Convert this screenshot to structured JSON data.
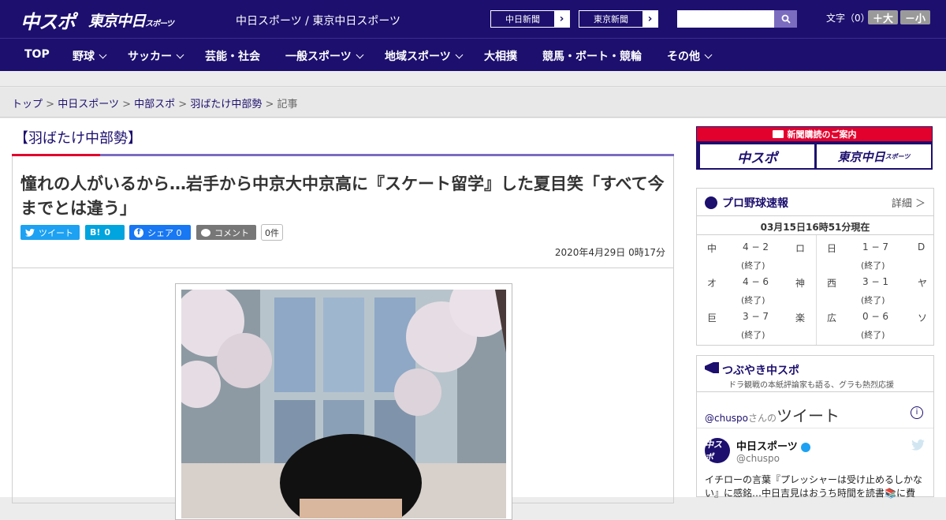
{
  "header": {
    "logo_main": "中スポ",
    "logo_tokyo": "東京中日",
    "logo_tokyo_small": "スポーツ",
    "site_title": "中日スポーツ / 東京中日スポーツ",
    "paper_links": [
      "中日新聞",
      "東京新聞"
    ],
    "search_placeholder": "",
    "font_size_label": "文字（0）",
    "font_plus": "＋大",
    "font_minus": "－小"
  },
  "nav": {
    "items": [
      {
        "label": "TOP",
        "dropdown": false
      },
      {
        "label": "野球",
        "dropdown": true
      },
      {
        "label": "サッカー",
        "dropdown": true
      },
      {
        "label": "芸能・社会",
        "dropdown": false
      },
      {
        "label": "一般スポーツ",
        "dropdown": true
      },
      {
        "label": "地域スポーツ",
        "dropdown": true
      },
      {
        "label": "大相撲",
        "dropdown": false
      },
      {
        "label": "競馬・ボート・競輪",
        "dropdown": false
      },
      {
        "label": "その他",
        "dropdown": true
      }
    ]
  },
  "breadcrumb": {
    "items": [
      "トップ",
      "中日スポーツ",
      "中部スポ",
      "羽ばたけ中部勢"
    ],
    "current": "記事",
    "sep": ">"
  },
  "article": {
    "category": "【羽ばたけ中部勢】",
    "title": "憧れの人がいるから…岩手から中京大中京高に『スケート留学』した夏目笑「すべて今までとは違う」",
    "share": {
      "tweet": "ツイート",
      "hatena_label": "B!",
      "hatena_count": "0",
      "facebook": "シェア 0",
      "comment": "コメント",
      "comment_count": "0件"
    },
    "date": "2020年4月29日 0時17分"
  },
  "sidebar": {
    "subscribe": {
      "header": "新聞購読のご案内",
      "logos": [
        "中スポ",
        "東京中日"
      ],
      "logo_small": "スポーツ"
    },
    "baseball": {
      "title": "プロ野球速報",
      "detail": "詳細 ＞",
      "time": "03月15日16時51分現在",
      "games": [
        {
          "home": "中",
          "score": "4 − 2",
          "away": "ロ",
          "status": "(終了)"
        },
        {
          "home": "日",
          "score": "1 − 7",
          "away": "D",
          "status": "(終了)"
        },
        {
          "home": "オ",
          "score": "4 − 6",
          "away": "神",
          "status": "(終了)"
        },
        {
          "home": "西",
          "score": "3 − 1",
          "away": "ヤ",
          "status": "(終了)"
        },
        {
          "home": "巨",
          "score": "3 − 7",
          "away": "楽",
          "status": "(終了)"
        },
        {
          "home": "広",
          "score": "0 − 6",
          "away": "ソ",
          "status": "(終了)"
        }
      ]
    },
    "twitter": {
      "title": "つぶやき中スポ",
      "subtitle": "ドラ観戦の本紙評論家も語る、グラも熱烈応援",
      "account": "@chuspo",
      "account_suffix": "さんの",
      "label": "ツイート",
      "name": "中日スポーツ",
      "handle": "@chuspo",
      "avatar": "中スポ",
      "text": "イチローの言葉『プレッシャーは受け止めるしかない』に感銘…中日吉見はおうち時間を読書📚に費"
    }
  },
  "colors": {
    "brand": "#1c0f6e",
    "accent_red": "#e2002d",
    "twitter": "#1da1f2",
    "hatena": "#00a4de",
    "facebook": "#1877f2",
    "comment": "#777777"
  }
}
